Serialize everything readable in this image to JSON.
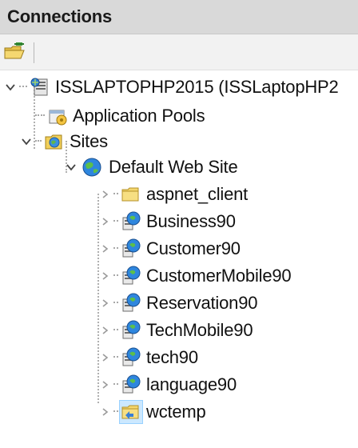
{
  "panel": {
    "title": "Connections"
  },
  "toolbar": {
    "connect_icon": "folder-connect-icon"
  },
  "tree": {
    "server": {
      "label": "ISSLAPTOPHP2015 (ISSLaptopHP2",
      "icon": "server-icon",
      "expanded": true
    },
    "app_pools": {
      "label": "Application Pools",
      "icon": "app-pool-icon"
    },
    "sites": {
      "label": "Sites",
      "icon": "sites-folder-icon",
      "expanded": true
    },
    "default_site": {
      "label": "Default Web Site",
      "icon": "globe-icon",
      "expanded": true
    },
    "children": [
      {
        "label": "aspnet_client",
        "icon": "folder-icon"
      },
      {
        "label": "Business90",
        "icon": "web-app-icon"
      },
      {
        "label": "Customer90",
        "icon": "web-app-icon"
      },
      {
        "label": "CustomerMobile90",
        "icon": "web-app-icon"
      },
      {
        "label": "Reservation90",
        "icon": "web-app-icon"
      },
      {
        "label": "TechMobile90",
        "icon": "web-app-icon"
      },
      {
        "label": "tech90",
        "icon": "web-app-icon"
      },
      {
        "label": "language90",
        "icon": "web-app-icon"
      },
      {
        "label": "wctemp",
        "icon": "virtual-dir-icon"
      }
    ]
  },
  "colors": {
    "header_bg": "#d9d9d9",
    "toolbar_bg": "#f2f2f2",
    "selection_bg": "#cce8ff"
  }
}
